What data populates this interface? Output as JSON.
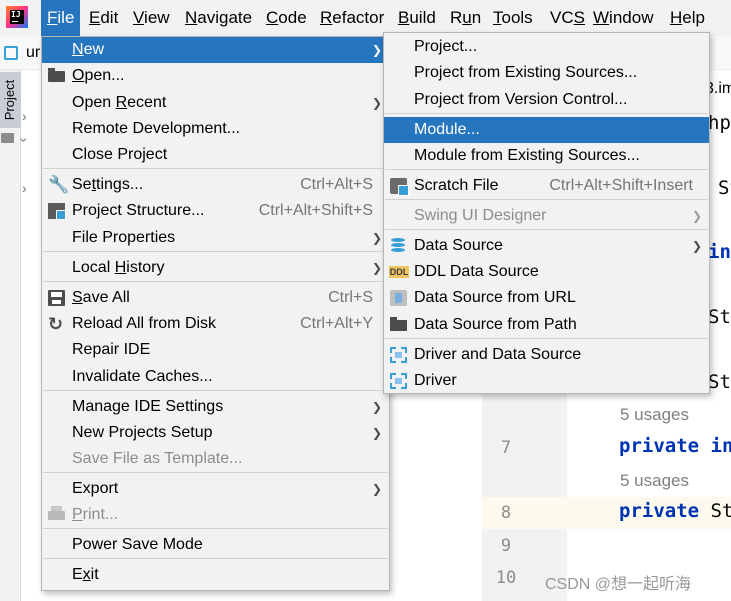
{
  "menubar": {
    "items": [
      "File",
      "Edit",
      "View",
      "Navigate",
      "Code",
      "Refactor",
      "Build",
      "Run",
      "Tools",
      "VCS",
      "Window",
      "Help"
    ],
    "mnemonics": [
      "F",
      "E",
      "V",
      "N",
      "C",
      "R",
      "B",
      "u",
      "T",
      "S",
      "W",
      "H"
    ],
    "active": "File"
  },
  "project": {
    "name_fragment": "ur",
    "tool_window_label": "Project"
  },
  "file_menu": {
    "items": [
      {
        "label": "New",
        "mn": "N",
        "submenu": true,
        "highlighted": true
      },
      {
        "label": "Open...",
        "mn": "O",
        "icon": "folder-icon"
      },
      {
        "label": "Open Recent",
        "mn": "R",
        "submenu": true
      },
      {
        "label": "Remote Development..."
      },
      {
        "label": "Close Project"
      },
      {
        "label": "Settings...",
        "mn": "t",
        "shortcut": "Ctrl+Alt+S",
        "icon": "wrench-icon"
      },
      {
        "label": "Project Structure...",
        "shortcut": "Ctrl+Alt+Shift+S",
        "icon": "project-structure-icon"
      },
      {
        "label": "File Properties",
        "submenu": true
      },
      {
        "label": "Local History",
        "mn": "H",
        "submenu": true
      },
      {
        "label": "Save All",
        "mn": "S",
        "shortcut": "Ctrl+S",
        "icon": "save-icon"
      },
      {
        "label": "Reload All from Disk",
        "shortcut": "Ctrl+Alt+Y",
        "icon": "reload-icon"
      },
      {
        "label": "Repair IDE"
      },
      {
        "label": "Invalidate Caches..."
      },
      {
        "label": "Manage IDE Settings",
        "submenu": true
      },
      {
        "label": "New Projects Setup",
        "submenu": true
      },
      {
        "label": "Save File as Template...",
        "disabled": true
      },
      {
        "label": "Export",
        "submenu": true
      },
      {
        "label": "Print...",
        "mn": "P",
        "disabled": true,
        "icon": "print-icon"
      },
      {
        "label": "Power Save Mode"
      },
      {
        "label": "Exit",
        "mn": "x"
      }
    ]
  },
  "new_submenu": {
    "items": [
      {
        "label": "Project..."
      },
      {
        "label": "Project from Existing Sources..."
      },
      {
        "label": "Project from Version Control..."
      },
      {
        "label": "Module...",
        "highlighted": true
      },
      {
        "label": "Module from Existing Sources..."
      },
      {
        "label": "Scratch File",
        "shortcut": "Ctrl+Alt+Shift+Insert",
        "icon": "scratch-file-icon"
      },
      {
        "label": "Swing UI Designer",
        "submenu": true,
        "disabled": true
      },
      {
        "label": "Data Source",
        "submenu": true,
        "icon": "database-icon"
      },
      {
        "label": "DDL Data Source",
        "icon": "ddl-icon"
      },
      {
        "label": "Data Source from URL",
        "icon": "url-icon"
      },
      {
        "label": "Data Source from Path",
        "icon": "folder-icon"
      },
      {
        "label": "Driver and Data Source",
        "icon": "driver-icon"
      },
      {
        "label": "Driver",
        "icon": "driver-icon"
      }
    ]
  },
  "editor": {
    "tab_fragment": "3.im",
    "fragments": [
      "hp",
      "St",
      "int",
      "St",
      "St"
    ],
    "usages": [
      "5 usages",
      "5 usages"
    ],
    "lines": [
      {
        "num": "7",
        "keyword": "private",
        "rest": "int"
      },
      {
        "num": "8",
        "keyword": "private",
        "rest": "St"
      },
      {
        "num": "9"
      },
      {
        "num": "10"
      }
    ]
  },
  "watermark": "CSDN @想一起听海"
}
